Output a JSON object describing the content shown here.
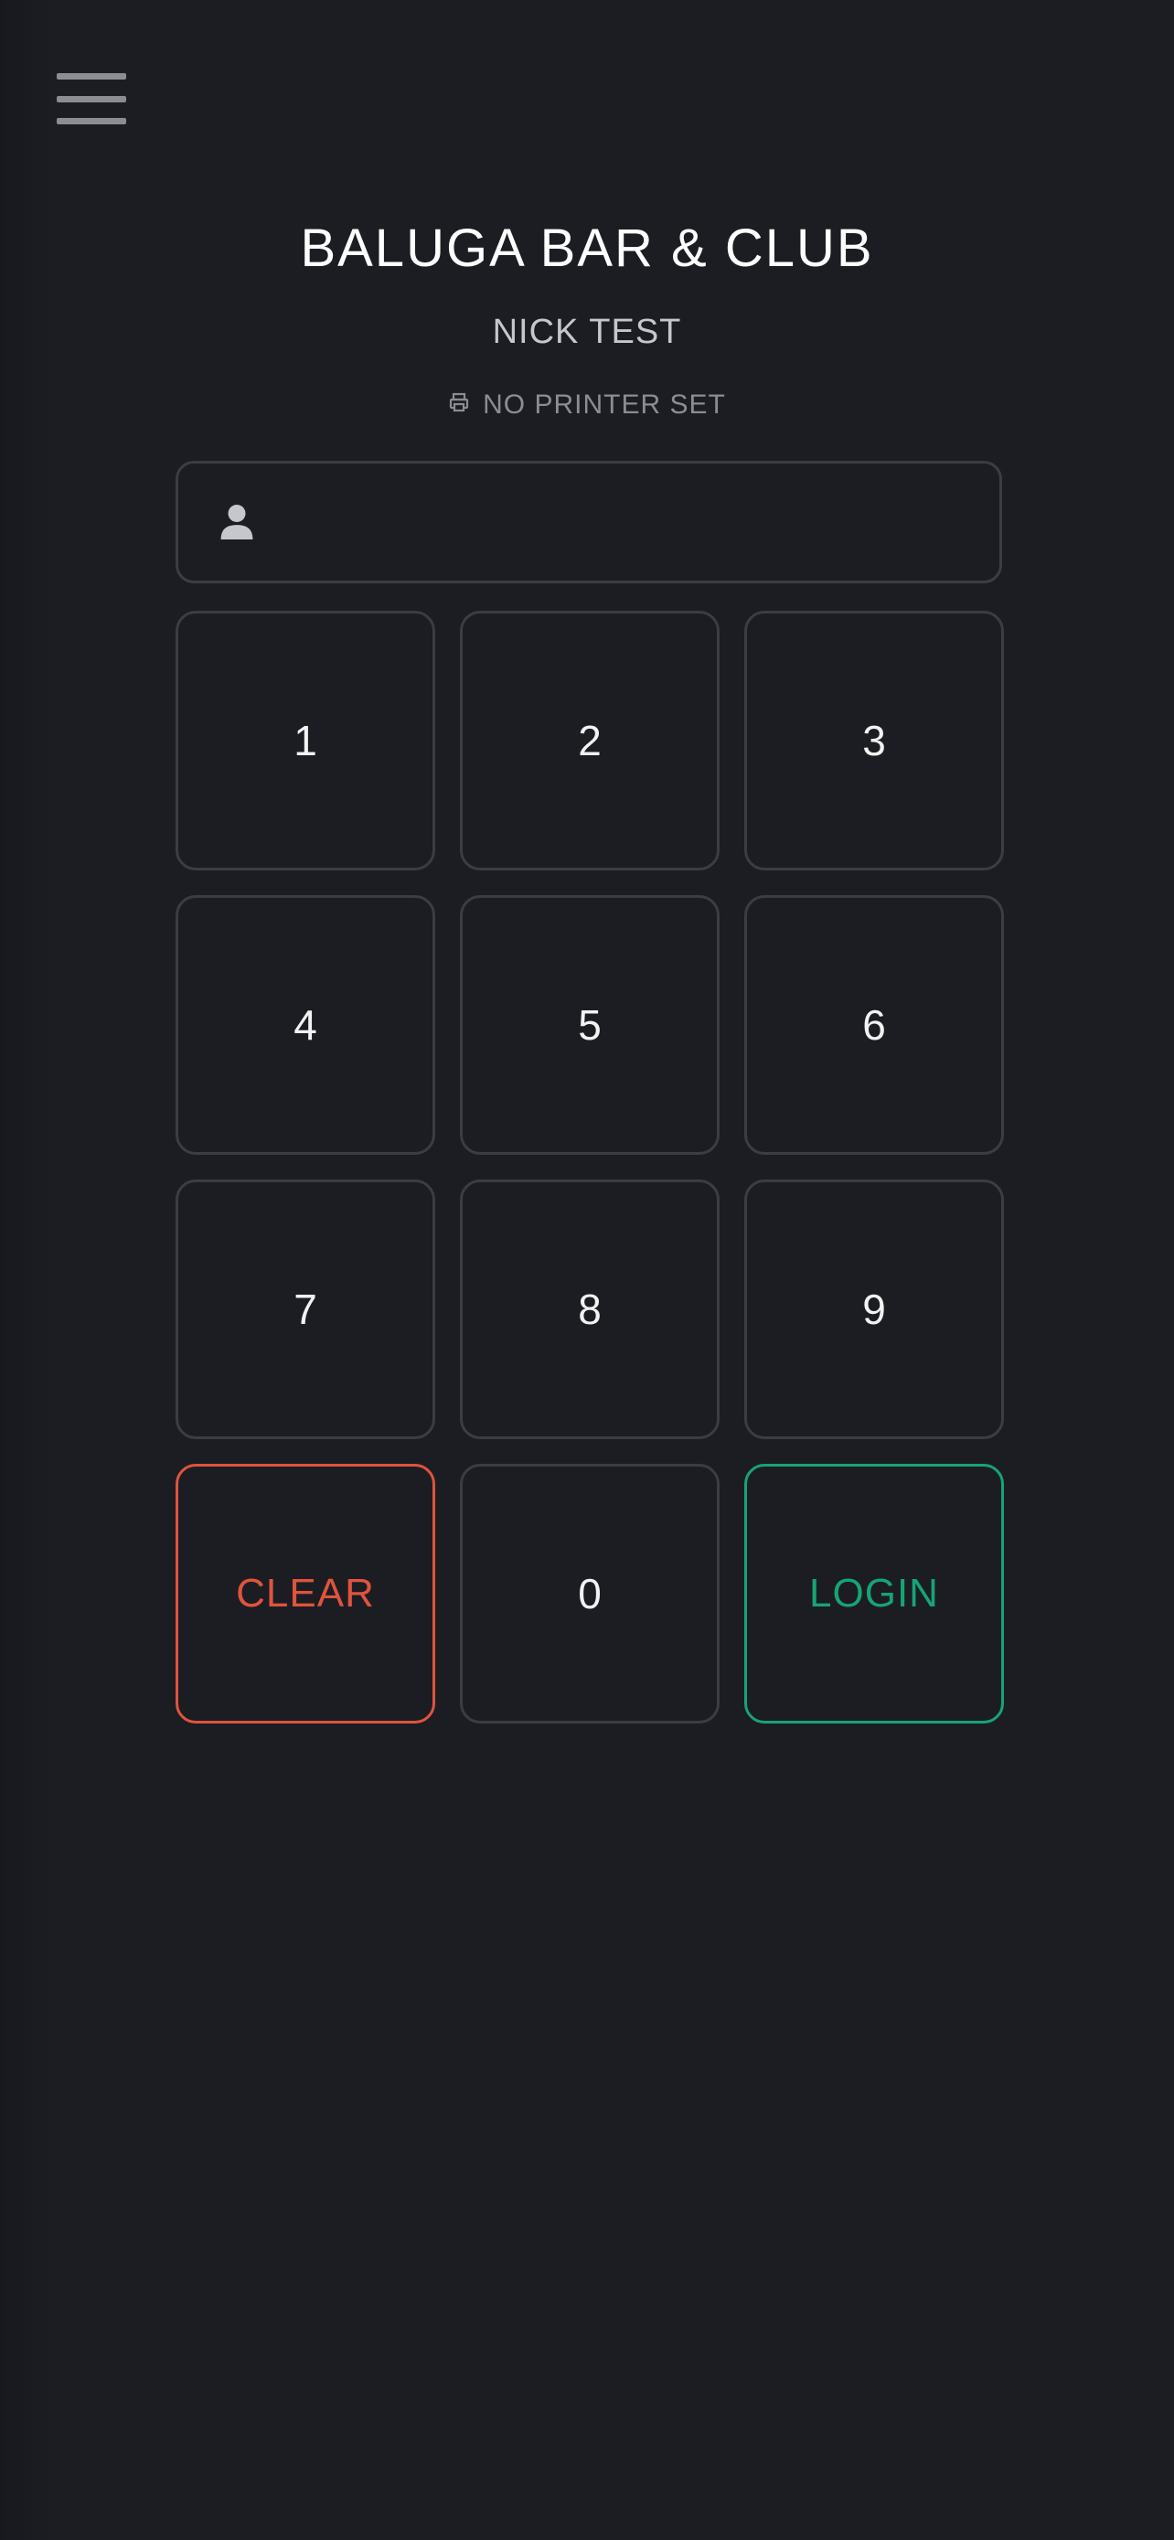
{
  "header": {
    "menu_icon": "hamburger-menu-icon",
    "venue_title": "BALUGA BAR & CLUB",
    "user_name": "NICK TEST",
    "printer_status": "NO PRINTER SET",
    "printer_icon": "printer-icon"
  },
  "pin_field": {
    "icon": "user-icon",
    "value": "",
    "placeholder": ""
  },
  "keypad": {
    "keys": [
      "1",
      "2",
      "3",
      "4",
      "5",
      "6",
      "7",
      "8",
      "9"
    ],
    "clear_label": "CLEAR",
    "zero_label": "0",
    "login_label": "LOGIN"
  },
  "colors": {
    "background": "#1b1d23",
    "key_border": "#3a3d44",
    "clear_accent": "#e0533d",
    "login_accent": "#17a474"
  }
}
